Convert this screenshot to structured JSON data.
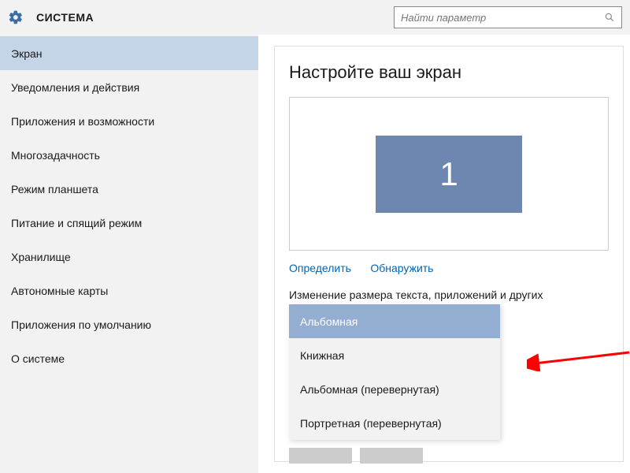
{
  "header": {
    "title": "СИСТЕМА",
    "search_placeholder": "Найти параметр"
  },
  "sidebar": {
    "items": [
      {
        "label": "Экран",
        "active": true
      },
      {
        "label": "Уведомления и действия",
        "active": false
      },
      {
        "label": "Приложения и возможности",
        "active": false
      },
      {
        "label": "Многозадачность",
        "active": false
      },
      {
        "label": "Режим планшета",
        "active": false
      },
      {
        "label": "Питание и спящий режим",
        "active": false
      },
      {
        "label": "Хранилище",
        "active": false
      },
      {
        "label": "Автономные карты",
        "active": false
      },
      {
        "label": "Приложения по умолчанию",
        "active": false
      },
      {
        "label": "О системе",
        "active": false
      }
    ]
  },
  "content": {
    "page_title": "Настройте ваш экран",
    "monitor_number": "1",
    "links": {
      "identify": "Определить",
      "detect": "Обнаружить"
    },
    "resize_label": "Изменение размера текста, приложений и других",
    "orientation": {
      "options": [
        {
          "label": "Альбомная",
          "selected": true
        },
        {
          "label": "Книжная",
          "selected": false
        },
        {
          "label": "Альбомная (перевернутая)",
          "selected": false
        },
        {
          "label": "Портретная (перевернутая)",
          "selected": false
        }
      ]
    }
  },
  "colors": {
    "accent": "#6d87b0",
    "selected_item": "#94aed2",
    "sidebar_active": "#c5d5e8",
    "link": "#0064b3",
    "arrow": "#ff0000"
  }
}
